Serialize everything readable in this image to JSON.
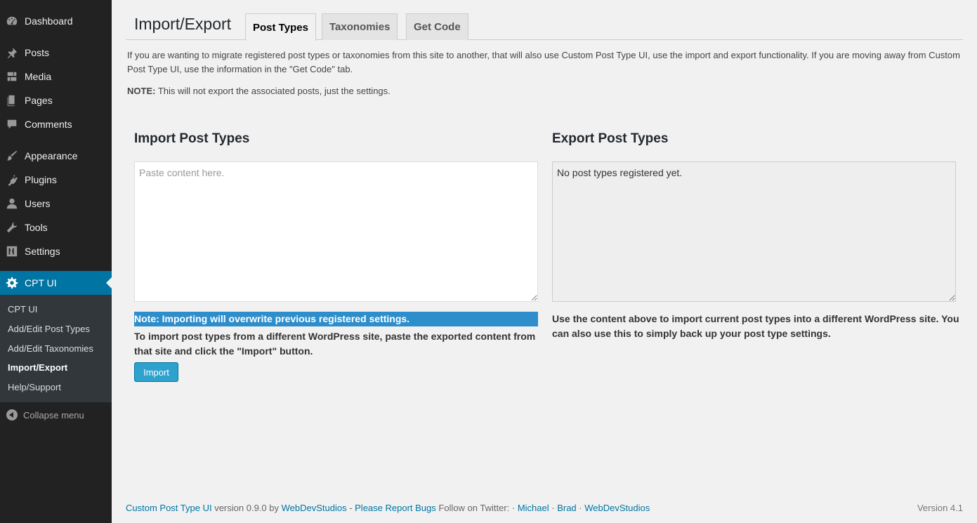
{
  "sidebar": {
    "items": [
      {
        "label": "Dashboard",
        "icon": "dashboard-icon"
      },
      {
        "label": "Posts",
        "icon": "pin-icon"
      },
      {
        "label": "Media",
        "icon": "media-icon"
      },
      {
        "label": "Pages",
        "icon": "pages-icon"
      },
      {
        "label": "Comments",
        "icon": "comment-icon"
      },
      {
        "label": "Appearance",
        "icon": "brush-icon"
      },
      {
        "label": "Plugins",
        "icon": "plug-icon"
      },
      {
        "label": "Users",
        "icon": "user-icon"
      },
      {
        "label": "Tools",
        "icon": "wrench-icon"
      },
      {
        "label": "Settings",
        "icon": "sliders-icon"
      },
      {
        "label": "CPT UI",
        "icon": "gear-icon"
      }
    ],
    "submenu": [
      "CPT UI",
      "Add/Edit Post Types",
      "Add/Edit Taxonomies",
      "Import/Export",
      "Help/Support"
    ],
    "collapse_label": "Collapse menu"
  },
  "header": {
    "title": "Import/Export",
    "tabs": [
      "Post Types",
      "Taxonomies",
      "Get Code"
    ]
  },
  "intro": "If you are wanting to migrate registered post types or taxonomies from this site to another, that will also use Custom Post Type UI, use the import and export functionality. If you are moving away from Custom Post Type UI, use the information in the \"Get Code\" tab.",
  "note": {
    "strong": "NOTE:",
    "text": " This will not export the associated posts, just the settings."
  },
  "import": {
    "title": "Import Post Types",
    "placeholder": "Paste content here.",
    "warning": "Note: Importing will overwrite previous registered settings.",
    "help": "To import post types from a different WordPress site, paste the exported content from that site and click the \"Import\" button.",
    "button": "Import"
  },
  "export": {
    "title": "Export Post Types",
    "value": "No post types registered yet.",
    "help": "Use the content above to import current post types into a different WordPress site. You can also use this to simply back up your post type settings."
  },
  "footer": {
    "plugin_link": "Custom Post Type UI",
    "version_text": " version 0.9.0 by ",
    "author_link": "WebDevStudios",
    "sep1": " - ",
    "bugs_link": "Please Report Bugs",
    "follow_text": " Follow on Twitter: · ",
    "twitter1": "Michael",
    "sep2": " · ",
    "twitter2": "Brad",
    "sep3": " · ",
    "twitter3": "WebDevStudios",
    "wp_version": "Version 4.1"
  },
  "colors": {
    "accent": "#0074a2",
    "warning_bg": "#2e8ecb",
    "button": "#2ea2cc",
    "sidebar": "#222222"
  }
}
